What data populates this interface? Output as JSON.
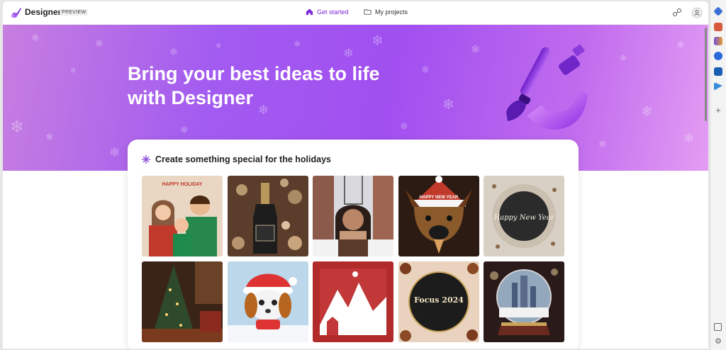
{
  "app": {
    "brand": "Designer",
    "badge": "PREVIEW"
  },
  "nav": {
    "tabs": [
      {
        "label": "Get started",
        "icon": "home-icon",
        "active": true
      },
      {
        "label": "My projects",
        "icon": "folder-icon",
        "active": false
      }
    ]
  },
  "header_icons": [
    "share-icon",
    "profile-icon"
  ],
  "hero": {
    "title_line1": "Bring your best ideas to life",
    "title_line2": "with Designer",
    "art_icon": "paintbrush-icon"
  },
  "holidays": {
    "title": "Create something special for the holidays",
    "icon": "snowflake-icon",
    "images": [
      {
        "icon": "family-portrait-image",
        "text": "HAPPY HOLIDAY"
      },
      {
        "icon": "champagne-bottle-image",
        "text": ""
      },
      {
        "icon": "girl-in-snowy-city-image",
        "text": ""
      },
      {
        "icon": "dog-in-santa-hat-image",
        "text": "HAPPY NEW YEAR"
      },
      {
        "icon": "happy-new-year-lettering-image",
        "text": "Happy New Year"
      },
      {
        "icon": "christmas-tree-books-image",
        "text": ""
      },
      {
        "icon": "puppy-in-santa-hat-image",
        "text": ""
      },
      {
        "icon": "paper-cut-mountains-image",
        "text": ""
      },
      {
        "icon": "focus-2024-image",
        "text": "Focus 2024"
      },
      {
        "icon": "snow-globe-city-image",
        "text": ""
      }
    ]
  },
  "side_rail_icons": [
    "tag-icon",
    "briefcase-icon",
    "figure-icon",
    "hexagon-icon",
    "outlook-icon",
    "send-icon",
    "add-icon",
    "split-view-icon",
    "settings-icon"
  ],
  "colors": {
    "accent": "#7f28d9",
    "hero_start": "#c77ee0",
    "hero_mid": "#a14ff0",
    "hero_end": "#e39df3"
  }
}
